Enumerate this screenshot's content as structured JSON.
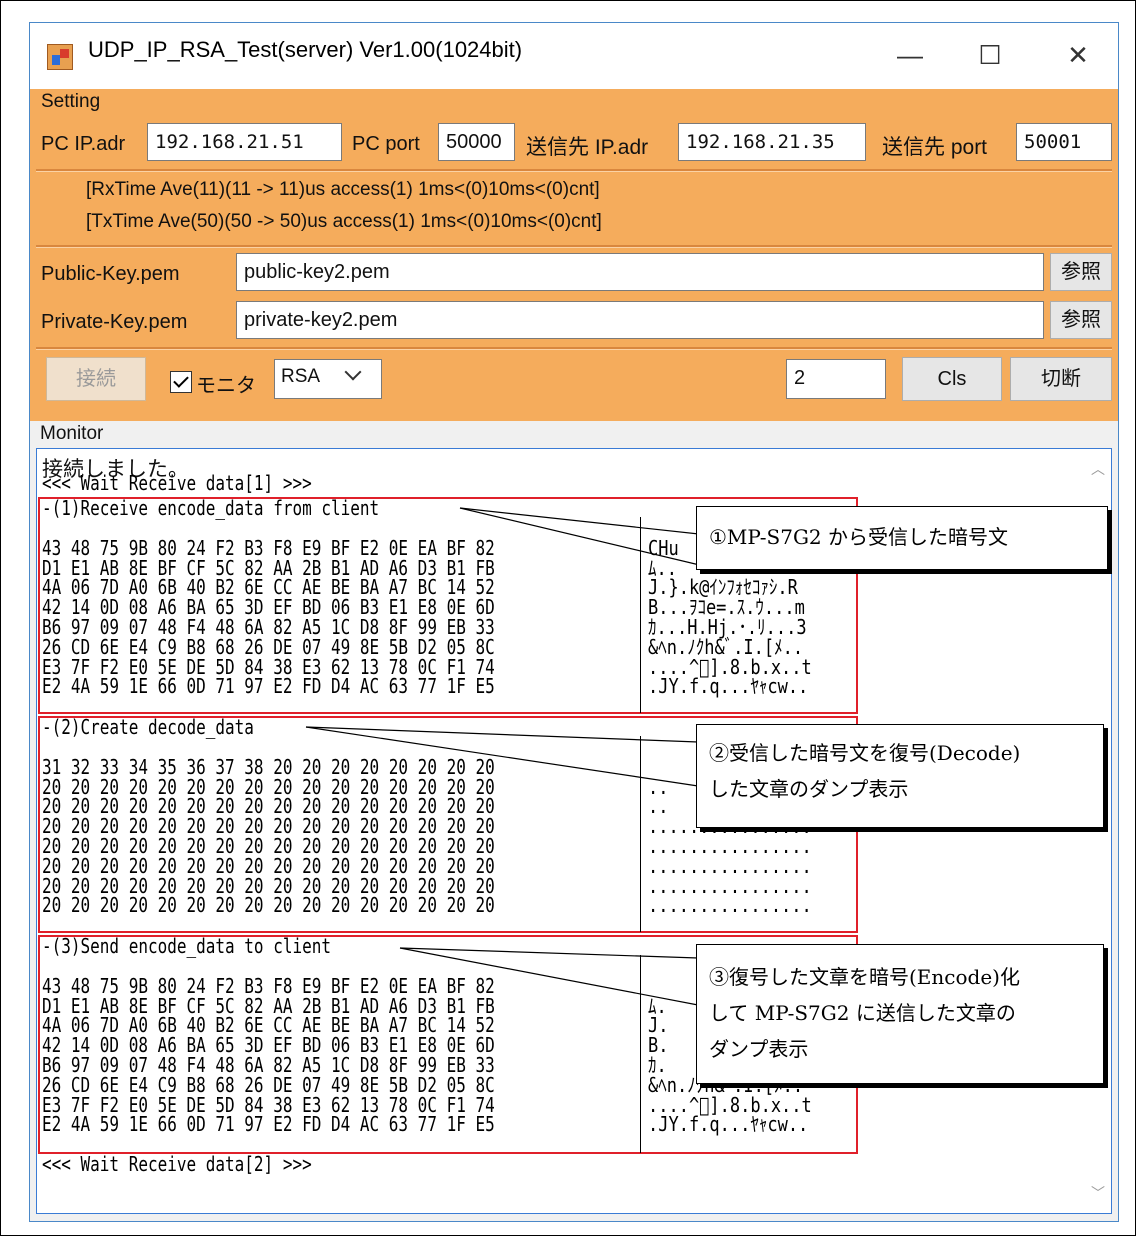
{
  "window": {
    "title": "UDP_IP_RSA_Test(server) Ver1.00(1024bit)",
    "minimize": "—",
    "maximize": "☐",
    "close": "✕"
  },
  "setting": {
    "group_label": "Setting",
    "pc_ip_label": "PC IP.adr",
    "pc_ip_value": "192.168.21.51",
    "pc_port_label": "PC port",
    "pc_port_value": "50000",
    "dest_ip_label": "送信先 IP.adr",
    "dest_ip_value": "192.168.21.35",
    "dest_port_label": "送信先 port",
    "dest_port_value": "50001"
  },
  "status": {
    "rx": "[RxTime Ave(11)(11 -> 11)us access(1) 1ms<(0)10ms<(0)cnt]",
    "tx": "[TxTime Ave(50)(50 -> 50)us access(1) 1ms<(0)10ms<(0)cnt]"
  },
  "keys": {
    "public_label": "Public-Key.pem",
    "public_value": "public-key2.pem",
    "private_label": "Private-Key.pem",
    "private_value": "private-key2.pem",
    "browse_label": "参照"
  },
  "controls": {
    "connect_label": "接続",
    "monitor_label": "モニタ",
    "algo_value": "RSA",
    "count_value": "2",
    "cls_label": "Cls",
    "disconnect_label": "切断"
  },
  "monitor": {
    "group_label": "Monitor",
    "line_connected": "接続しました。",
    "line_wait1": "<<< Wait Receive data[1] >>>",
    "sec1_header": "-(1)Receive encode_data from client",
    "sec1_hex": [
      "43 48 75 9B 80 24 F2 B3 F8 E9 BF E2 0E EA BF 82",
      "D1 E1 AB 8E BF CF 5C 82 AA 2B B1 AD A6 D3 B1 FB",
      "4A 06 7D A0 6B 40 B2 6E CC AE BE BA A7 BC 14 52",
      "42 14 0D 08 A6 BA 65 3D EF BD 06 B3 E1 E8 0E 6D",
      "B6 97 09 07 48 F4 48 6A 82 A5 1C D8 8F 99 EB 33",
      "26 CD 6E E4 C9 B8 68 26 DE 07 49 8E 5B D2 05 8C",
      "E3 7F F2 E0 5E DE 5D 84 38 E3 62 13 78 0C F1 74",
      "E2 4A 59 1E 66 0D 71 97 E2 FD D4 AC 63 77 1F E5"
    ],
    "sec1_ascii": [
      "CHu",
      "ﾑ..",
      "J.}.k@ｲﾝﾌｫｾｺｧｼ.R",
      "B...ｦｺe=.ｽ.ｳ...m",
      "ｶ...H.Hj.･.ﾘ...3",
      "&ﾍn.ﾉｸh&ﾞ.I.[ﾒ..",
      "....^ﾞ].8.b.x..t",
      ".JY.f.q...ﾔｬcw.."
    ],
    "sec2_header": "-(2)Create decode_data",
    "sec2_hex": [
      "31 32 33 34 35 36 37 38 20 20 20 20 20 20 20 20",
      "20 20 20 20 20 20 20 20 20 20 20 20 20 20 20 20",
      "20 20 20 20 20 20 20 20 20 20 20 20 20 20 20 20",
      "20 20 20 20 20 20 20 20 20 20 20 20 20 20 20 20",
      "20 20 20 20 20 20 20 20 20 20 20 20 20 20 20 20",
      "20 20 20 20 20 20 20 20 20 20 20 20 20 20 20 20",
      "20 20 20 20 20 20 20 20 20 20 20 20 20 20 20 20",
      "20 20 20 20 20 20 20 20 20 20 20 20 20 20 20 20"
    ],
    "sec2_ascii": [
      "",
      "..",
      "..",
      "................",
      "................",
      "................",
      "................",
      "................"
    ],
    "sec3_header": "-(3)Send encode_data to client",
    "sec3_hex": [
      "43 48 75 9B 80 24 F2 B3 F8 E9 BF E2 0E EA BF 82",
      "D1 E1 AB 8E BF CF 5C 82 AA 2B B1 AD A6 D3 B1 FB",
      "4A 06 7D A0 6B 40 B2 6E CC AE BE BA A7 BC 14 52",
      "42 14 0D 08 A6 BA 65 3D EF BD 06 B3 E1 E8 0E 6D",
      "B6 97 09 07 48 F4 48 6A 82 A5 1C D8 8F 99 EB 33",
      "26 CD 6E E4 C9 B8 68 26 DE 07 49 8E 5B D2 05 8C",
      "E3 7F F2 E0 5E DE 5D 84 38 E3 62 13 78 0C F1 74",
      "E2 4A 59 1E 66 0D 71 97 E2 FD D4 AC 63 77 1F E5"
    ],
    "sec3_ascii": [
      "",
      "ﾑ.",
      "J.",
      "B.",
      "ｶ.",
      "&ﾍn.ﾉｸh&ﾞ.I.[ﾒ..",
      "....^ﾞ].8.b.x..t",
      ".JY.f.q...ﾔｬcw.."
    ],
    "line_wait2": "<<< Wait Receive data[2] >>>"
  },
  "callouts": {
    "c1": "①MP-S7G2 から受信した暗号文",
    "c2": "②受信した暗号文を復号(Decode)\nした文章のダンプ表示",
    "c3": "③復号した文章を暗号(Encode)化\nして MP-S7G2 に送信した文章の\nダンプ表示"
  }
}
